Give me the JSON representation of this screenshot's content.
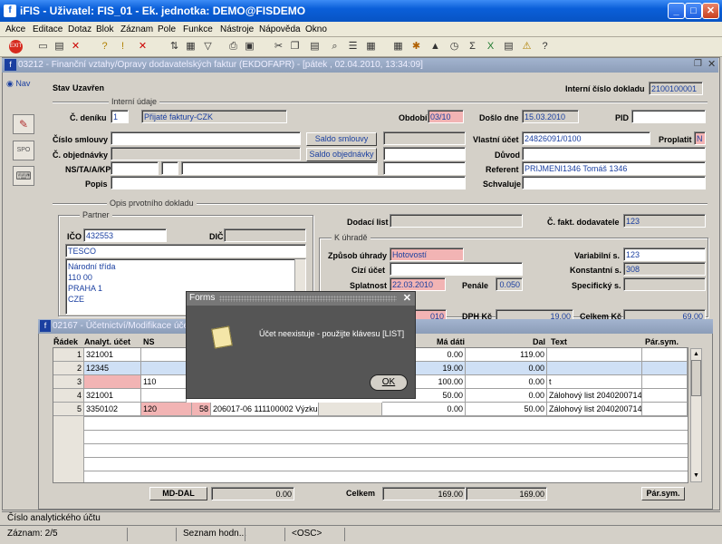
{
  "app": {
    "title": "iFIS - Uživatel: FIS_01 - Ek. jednotka: DEMO@FISDEMO"
  },
  "menu": [
    "Akce",
    "Editace",
    "Dotaz",
    "Blok",
    "Záznam",
    "Pole",
    "Funkce",
    "Nástroje",
    "Nápověda",
    "Okno"
  ],
  "toolbar_icons": [
    "exit-icon",
    "new-record-icon",
    "save-icon",
    "delete-icon",
    "enter-query-icon",
    "execute-query-icon",
    "filter-icon",
    "print-icon",
    "print-preview-icon",
    "cut-icon",
    "copy-icon",
    "paste-icon",
    "list-icon",
    "help-list-icon",
    "calculator-icon",
    "settings-icon",
    "chart-icon",
    "clock-icon",
    "sum-icon",
    "excel-icon",
    "export-icon",
    "info-icon",
    "help-icon"
  ],
  "form": {
    "title": "03212 - Finanční vztahy/Opravy dodavatelských faktur (EKDOFAPR) - [pátek , 02.04.2010, 13:34:09]",
    "nav_label": "Nav",
    "stav_label": "Stav",
    "stav_value": "Uzavřen",
    "interni_cislo_label": "Interní číslo dokladu",
    "interni_cislo_value": "2100100001",
    "interni_udaje_label": "Interní údaje",
    "c_deniku_label": "Č. deníku",
    "c_deniku_value": "1",
    "c_deniku_name": "Přijaté faktury-CZK",
    "obdobi_label": "Období",
    "obdobi_value": "03/10",
    "doslo_dne_label": "Došlo dne",
    "doslo_dne_value": "15.03.2010",
    "pid_label": "PID",
    "pid_value": "",
    "cislo_smlouvy_label": "Číslo smlouvy",
    "saldo_smlouvy_btn": "Saldo smlouvy",
    "c_objednavky_label": "Č. objednávky",
    "saldo_objednavky_btn": "Saldo objednávky",
    "vlastni_ucet_label": "Vlastní účet",
    "vlastni_ucet_value": "24826091/0100",
    "proplatit_label": "Proplatit",
    "proplatit_value": "N",
    "duvod_label": "Důvod",
    "nstaakp_label": "NS/TA/A/KP",
    "referent_label": "Referent",
    "referent_value": "PRIJMENI1346 Tomáš 1346",
    "popis_label": "Popis",
    "schvaluje_label": "Schvaluje",
    "opis_label": "Opis prvotního dokladu",
    "partner_label": "Partner",
    "ico_label": "IČO",
    "ico_value": "432553",
    "dic_label": "DIČ",
    "partner_name": "TESCO",
    "address_lines": [
      "Národní třída",
      "110 00",
      "PRAHA 1",
      "CZE"
    ],
    "dodaci_list_label": "Dodací list",
    "c_fakt_dod_label": "Č. fakt. dodavatele",
    "c_fakt_dod_value": "123",
    "k_uhrade_label": "K úhradě",
    "zpusob_uhrady_label": "Způsob úhrady",
    "zpusob_uhrady_value": "Hotovostí",
    "variabilni_label": "Variabilní s.",
    "variabilni_value": "123",
    "cizi_ucet_label": "Cizí účet",
    "konstantni_label": "Konstantní s.",
    "konstantni_value": "308",
    "splatnost_label": "Splatnost",
    "splatnost_value": "22.03.2010",
    "penale_label": "Penále",
    "penale_value": "0.050",
    "specificky_label": "Specifický s.",
    "hidden_row_values": [
      "010",
      "DPH Kč",
      "19.00",
      "Celkem Kč",
      "69.00"
    ]
  },
  "accounting": {
    "title": "02167 - Účetnictví/Modifikace účetn",
    "columns": [
      "Řádek",
      "Analyt. účet",
      "NS",
      "Má dáti",
      "Dal",
      "Text",
      "Pár.sym."
    ],
    "rows": [
      {
        "n": "1",
        "ucet": "321001",
        "ns": "",
        "ns2": "",
        "text2": "",
        "ma_dati": "0.00",
        "dal": "119.00",
        "text": ""
      },
      {
        "n": "2",
        "ucet": "12345",
        "ns": "",
        "ns2": "",
        "text2": "",
        "ma_dati": "19.00",
        "dal": "0.00",
        "text": ""
      },
      {
        "n": "3",
        "ucet": "",
        "ns": "110",
        "ns2": "",
        "text2": "",
        "ma_dati": "100.00",
        "dal": "0.00",
        "text": "t"
      },
      {
        "n": "4",
        "ucet": "321001",
        "ns": "",
        "ns2": "",
        "text2": "",
        "ma_dati": "50.00",
        "dal": "0.00",
        "text": "Zálohový list 2040200714"
      },
      {
        "n": "5",
        "ucet": "3350102",
        "ns": "120",
        "ns2": "58",
        "text2": "206017-06 111100002 Výzkum",
        "ma_dati": "0.00",
        "dal": "50.00",
        "text": "Zálohový list 2040200714"
      }
    ],
    "md_dal_btn": "MD-DAL",
    "md_dal_value": "0.00",
    "celkem_label": "Celkem",
    "celkem_md": "169.00",
    "celkem_dal": "169.00",
    "par_sym_btn": "Pár.sym."
  },
  "dialog": {
    "title": "Forms",
    "message": "Účet neexistuje - použijte klávesu [LIST]",
    "ok": "OK"
  },
  "hint": "Číslo analytického účtu",
  "status": {
    "zaznam": "Záznam: 2/5",
    "list": "Seznam hodn...",
    "osc": "<OSC>"
  }
}
